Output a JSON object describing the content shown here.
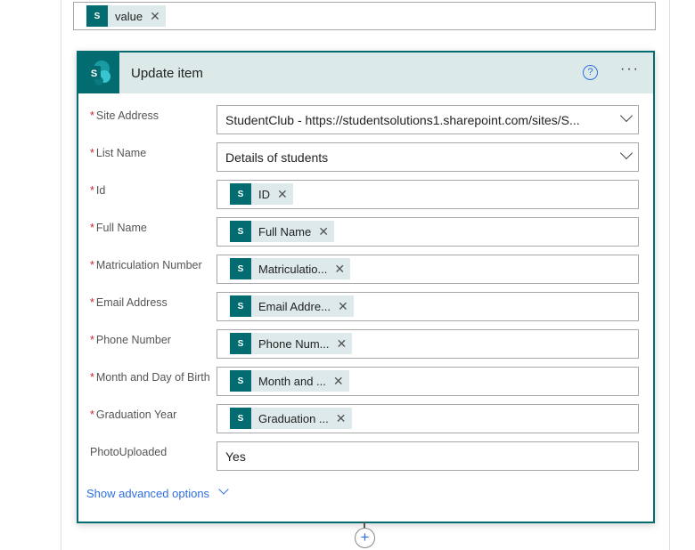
{
  "top_input": {
    "token": "value"
  },
  "card": {
    "title": "Update item",
    "help_icon": "?",
    "more_icon": "···"
  },
  "fields": [
    {
      "label": "Site Address",
      "required": true,
      "type": "dropdown",
      "value": "StudentClub - https://studentsolutions1.sharepoint.com/sites/S..."
    },
    {
      "label": "List Name",
      "required": true,
      "type": "dropdown",
      "value": "Details of students"
    },
    {
      "label": "Id",
      "required": true,
      "type": "token",
      "value": "ID"
    },
    {
      "label": "Full Name",
      "required": true,
      "type": "token",
      "value": "Full Name"
    },
    {
      "label": "Matriculation Number",
      "required": true,
      "type": "token",
      "value": "Matriculatio..."
    },
    {
      "label": "Email Address",
      "required": true,
      "type": "token",
      "value": "Email Addre..."
    },
    {
      "label": "Phone Number",
      "required": true,
      "type": "token",
      "value": "Phone Num..."
    },
    {
      "label": "Month and Day of Birth",
      "required": true,
      "type": "token",
      "value": "Month and ..."
    },
    {
      "label": "Graduation Year",
      "required": true,
      "type": "token",
      "value": "Graduation ..."
    },
    {
      "label": "PhotoUploaded",
      "required": false,
      "type": "text",
      "value": "Yes"
    }
  ],
  "required_mark": "*",
  "sp_letter": "S",
  "remove_icon": "✕",
  "advanced": "Show advanced options",
  "add_step": "+",
  "colors": {
    "teal": "#036c70",
    "accent": "#2f6fe0",
    "required": "#c4262e"
  }
}
